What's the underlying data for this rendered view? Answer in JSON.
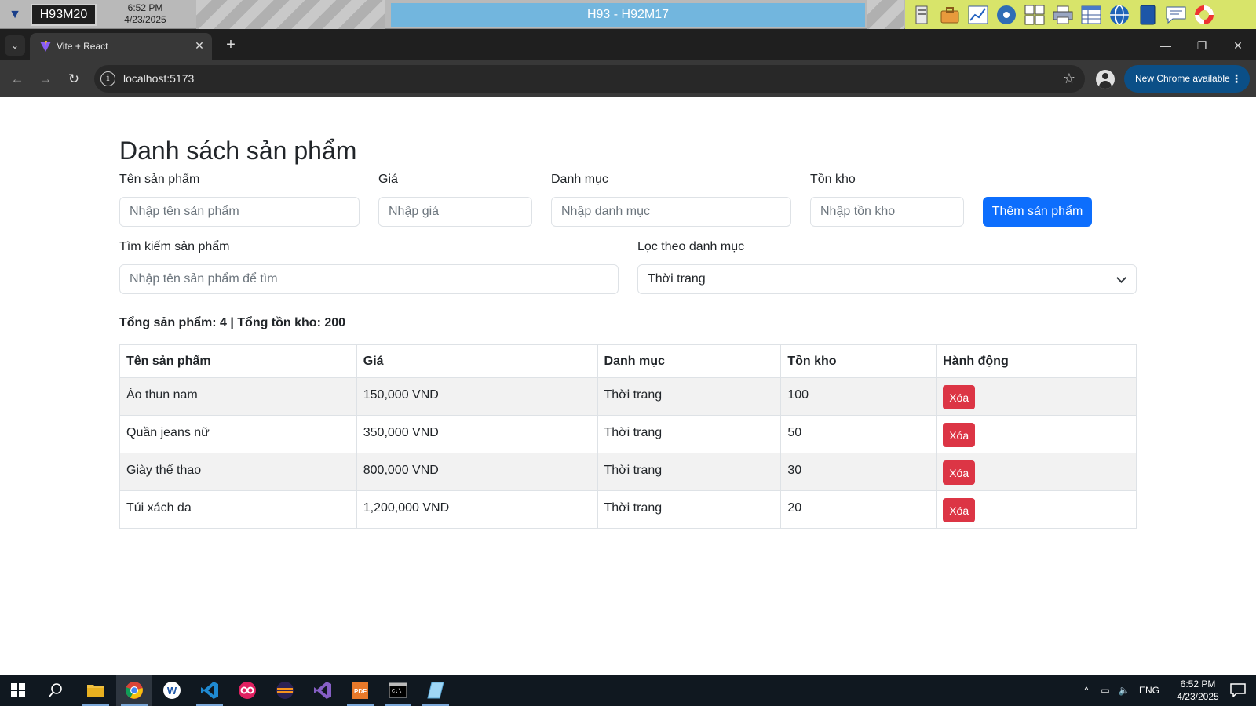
{
  "remote_bar": {
    "machine": "H93M20",
    "time": "6:52 PM",
    "date": "4/23/2025",
    "title": "H93 - H92M17",
    "tools": [
      "server-icon",
      "briefcase-icon",
      "chart-icon",
      "disc-icon",
      "keyboard-icon",
      "printer-icon",
      "grid-window-icon",
      "globe-icon",
      "book-icon",
      "chat-icon",
      "lifebuoy-icon"
    ]
  },
  "browser": {
    "tab_title": "Vite + React",
    "url": "localhost:5173",
    "update_label": "New Chrome available",
    "update_menu": "⋮"
  },
  "page": {
    "title": "Danh sách sản phẩm",
    "form": {
      "name_label": "Tên sản phẩm",
      "name_placeholder": "Nhập tên sản phẩm",
      "price_label": "Giá",
      "price_placeholder": "Nhập giá",
      "category_label": "Danh mục",
      "category_placeholder": "Nhập danh mục",
      "stock_label": "Tồn kho",
      "stock_placeholder": "Nhập tồn kho",
      "add_button": "Thêm sản phẩm"
    },
    "search": {
      "label": "Tìm kiếm sản phẩm",
      "placeholder": "Nhập tên sản phẩm để tìm"
    },
    "filter": {
      "label": "Lọc theo danh mục",
      "selected": "Thời trang"
    },
    "summary": "Tổng sản phẩm: 4 | Tổng tồn kho: 200",
    "table": {
      "headers": [
        "Tên sản phẩm",
        "Giá",
        "Danh mục",
        "Tồn kho",
        "Hành động"
      ],
      "rows": [
        {
          "name": "Áo thun nam",
          "price": "150,000 VND",
          "category": "Thời trang",
          "stock": "100",
          "action": "Xóa"
        },
        {
          "name": "Quần jeans nữ",
          "price": "350,000 VND",
          "category": "Thời trang",
          "stock": "50",
          "action": "Xóa"
        },
        {
          "name": "Giày thể thao",
          "price": "800,000 VND",
          "category": "Thời trang",
          "stock": "30",
          "action": "Xóa"
        },
        {
          "name": "Túi xách da",
          "price": "1,200,000 VND",
          "category": "Thời trang",
          "stock": "20",
          "action": "Xóa"
        }
      ]
    }
  },
  "taskbar": {
    "apps": [
      "file-explorer-icon",
      "chrome-icon",
      "word-icon",
      "origin-icon",
      "eclipse-icon",
      "visual-studio-icon",
      "pdf-icon",
      "terminal-icon",
      "notepad-icon"
    ],
    "language": "ENG",
    "time": "6:52 PM",
    "date": "4/23/2025"
  }
}
